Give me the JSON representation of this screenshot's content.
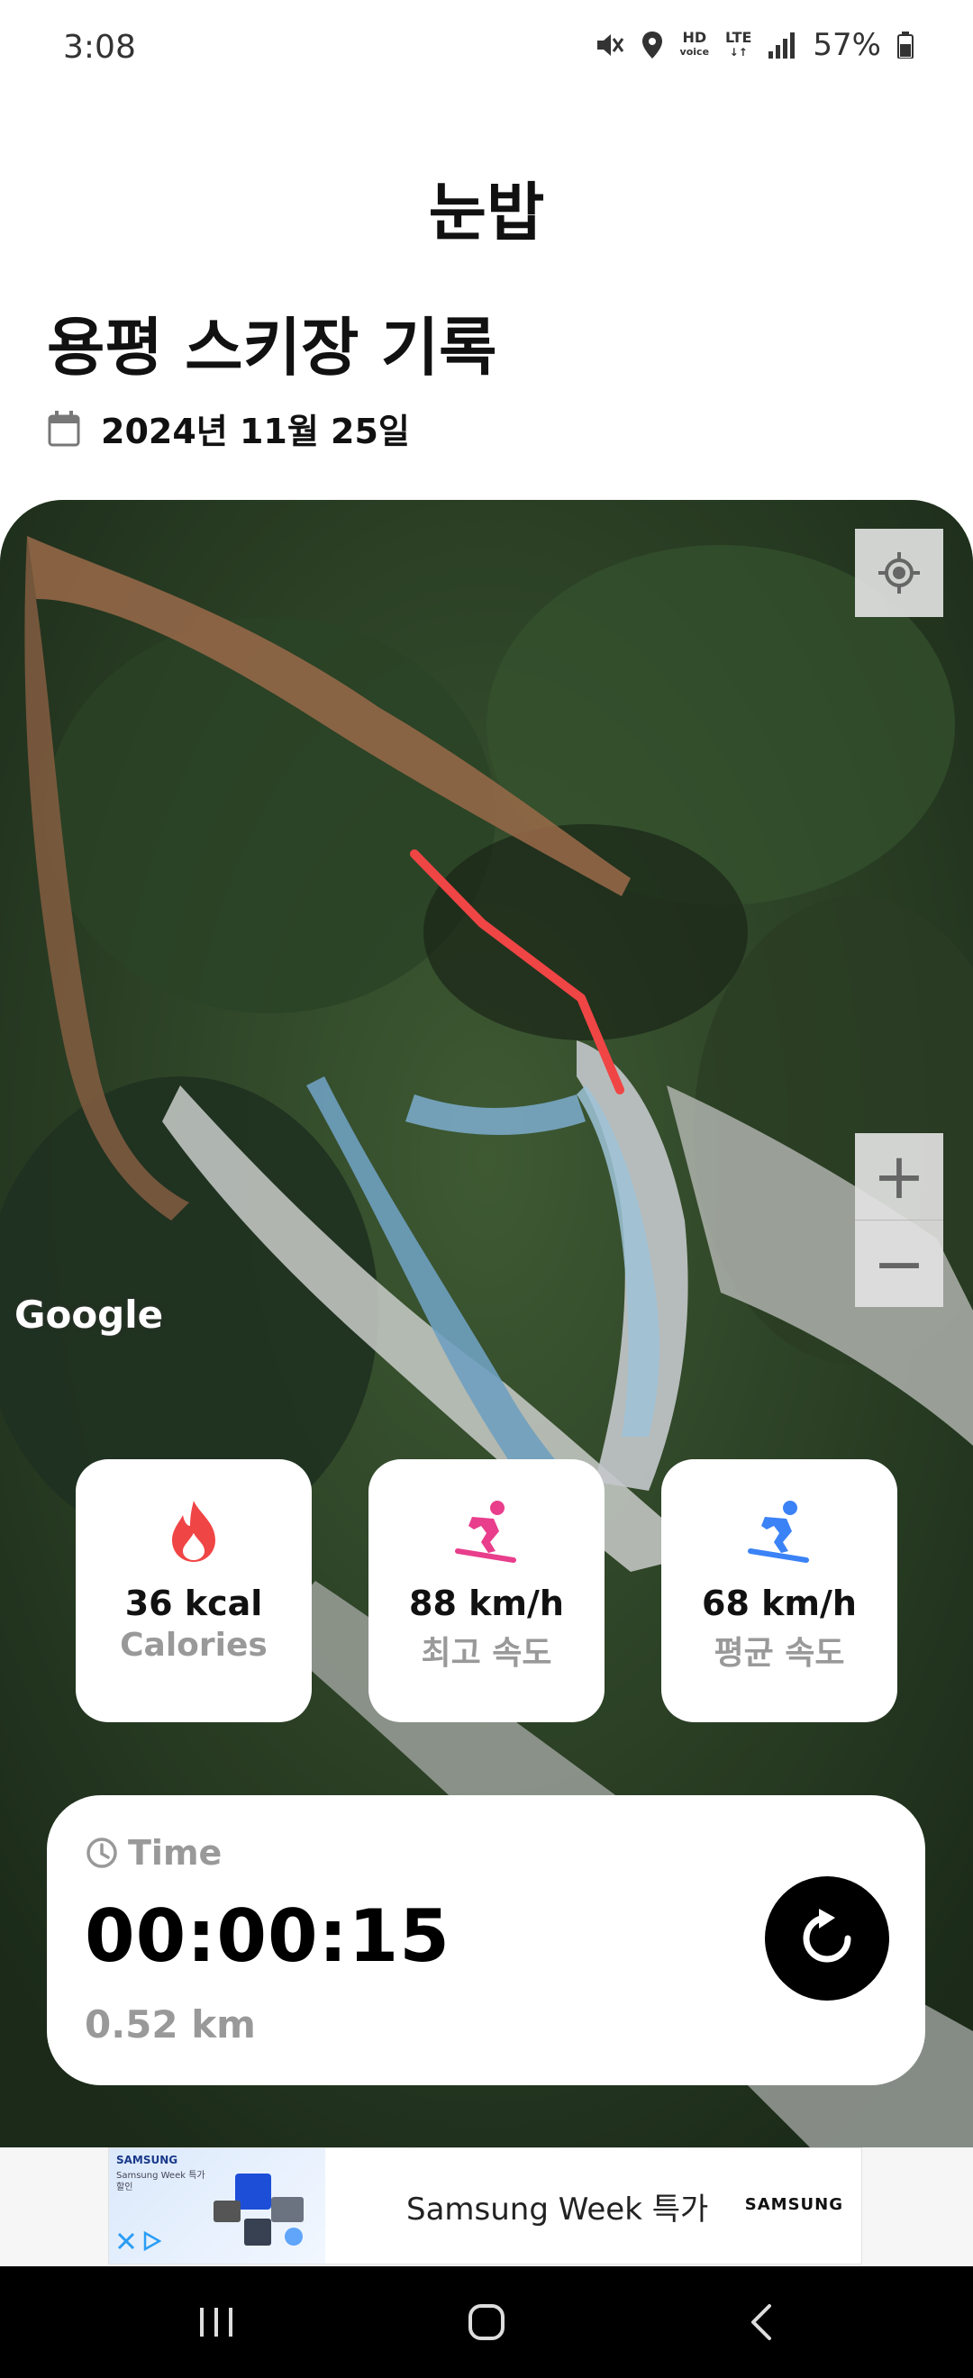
{
  "status_bar": {
    "time": "3:08",
    "network_hd": "HD",
    "network_voice": "voice",
    "network_lte": "LTE",
    "battery": "57%"
  },
  "app": {
    "title": "눈밥"
  },
  "record": {
    "title": "용평 스키장 기록",
    "date": "2024년 11월 25일"
  },
  "map": {
    "attribution": "Google",
    "zoom_in": "+",
    "zoom_out": "−",
    "route_color": "#f04545"
  },
  "stats": [
    {
      "value": "36 kcal",
      "label": "Calories",
      "icon": "flame-icon",
      "color": "#f04545"
    },
    {
      "value": "88 km/h",
      "label": "최고 속도",
      "icon": "snowboarder-icon",
      "color": "#e83e8c"
    },
    {
      "value": "68 km/h",
      "label": "평균 속도",
      "icon": "snowboarder-icon",
      "color": "#3b82f6"
    }
  ],
  "timer": {
    "label": "Time",
    "value": "00:00:15",
    "distance": "0.52 km"
  },
  "ad": {
    "text": "Samsung Week 특가",
    "brand": "SAMSUNG",
    "thumb_brand": "SAMSUNG",
    "thumb_text": "Samsung Week 특가 할인"
  }
}
